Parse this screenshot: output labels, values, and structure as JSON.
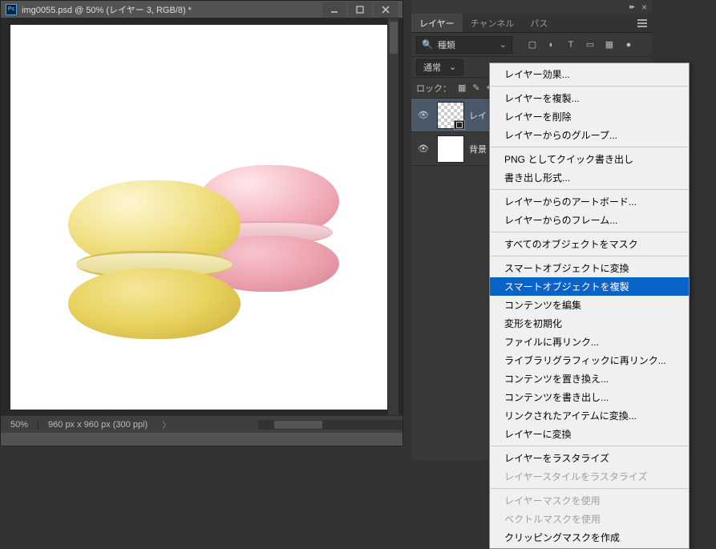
{
  "document": {
    "app_icon_text": "Ps",
    "title": "img0055.psd @ 50% (レイヤー 3, RGB/8) *",
    "zoom": "50%",
    "dimensions": "960 px x 960 px (300 ppi)",
    "chevron": "〉"
  },
  "panel": {
    "tabs": {
      "layers": "レイヤー",
      "channels": "チャンネル",
      "paths": "パス"
    },
    "filter": {
      "label": "種類",
      "search_icon": "🔍",
      "chev": "⌄"
    },
    "filter_icons": {
      "image": "▢",
      "adjust": "◐",
      "text": "T",
      "shape": "▭",
      "smart": "▦",
      "toggle": "●"
    },
    "blend_mode": "通常",
    "lock_label": "ロック：",
    "lock_icons": {
      "pixels": "▦",
      "brush": "✎",
      "move": "✥"
    },
    "layers": [
      {
        "name": "レイ",
        "eye": "👁",
        "selected": true,
        "checker": true,
        "smart_badge": true
      },
      {
        "name": "背景",
        "eye": "👁",
        "selected": false,
        "checker": false,
        "smart_badge": false
      }
    ]
  },
  "context_menu": {
    "items": [
      {
        "label": "レイヤー効果...",
        "type": "item"
      },
      {
        "type": "sep"
      },
      {
        "label": "レイヤーを複製...",
        "type": "item"
      },
      {
        "label": "レイヤーを削除",
        "type": "item"
      },
      {
        "label": "レイヤーからのグループ...",
        "type": "item"
      },
      {
        "type": "sep"
      },
      {
        "label": "PNG としてクイック書き出し",
        "type": "item"
      },
      {
        "label": "書き出し形式...",
        "type": "item"
      },
      {
        "type": "sep"
      },
      {
        "label": "レイヤーからのアートボード...",
        "type": "item"
      },
      {
        "label": "レイヤーからのフレーム...",
        "type": "item"
      },
      {
        "type": "sep"
      },
      {
        "label": "すべてのオブジェクトをマスク",
        "type": "item"
      },
      {
        "type": "sep"
      },
      {
        "label": "スマートオブジェクトに変換",
        "type": "item"
      },
      {
        "label": "スマートオブジェクトを複製",
        "type": "item",
        "highlight": true
      },
      {
        "label": "コンテンツを編集",
        "type": "item"
      },
      {
        "label": "変形を初期化",
        "type": "item"
      },
      {
        "label": "ファイルに再リンク...",
        "type": "item"
      },
      {
        "label": "ライブラリグラフィックに再リンク...",
        "type": "item"
      },
      {
        "label": "コンテンツを置き換え...",
        "type": "item"
      },
      {
        "label": "コンテンツを書き出し...",
        "type": "item"
      },
      {
        "label": "リンクされたアイテムに変換...",
        "type": "item"
      },
      {
        "label": "レイヤーに変換",
        "type": "item"
      },
      {
        "type": "sep"
      },
      {
        "label": "レイヤーをラスタライズ",
        "type": "item"
      },
      {
        "label": "レイヤースタイルをラスタライズ",
        "type": "item",
        "disabled": true
      },
      {
        "type": "sep"
      },
      {
        "label": "レイヤーマスクを使用",
        "type": "item",
        "disabled": true
      },
      {
        "label": "ベクトルマスクを使用",
        "type": "item",
        "disabled": true
      },
      {
        "label": "クリッピングマスクを作成",
        "type": "item"
      }
    ]
  }
}
